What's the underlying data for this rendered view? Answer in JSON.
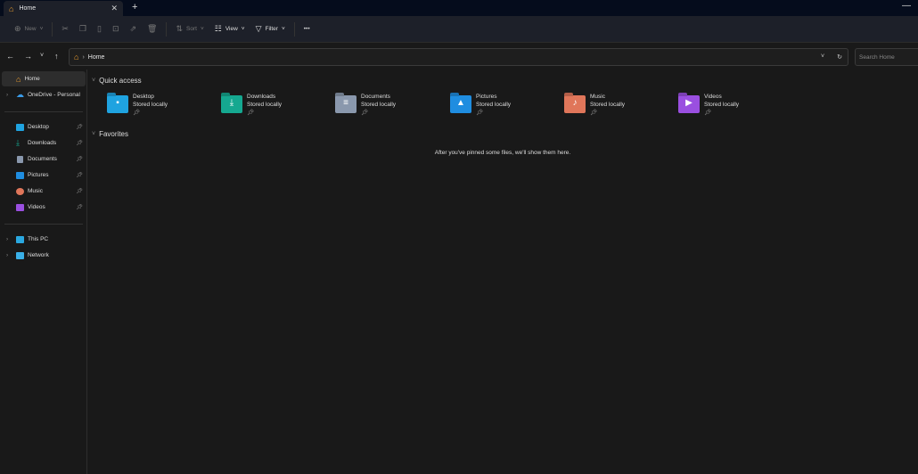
{
  "tab": {
    "title": "Home",
    "close": "✕",
    "new": "+"
  },
  "window": {
    "minimize": "—"
  },
  "toolbar": {
    "new": "New",
    "sort": "Sort",
    "view": "View",
    "filter": "Filter",
    "more": "•••"
  },
  "address": {
    "location": "Home",
    "search_placeholder": "Search Home"
  },
  "sidebar": {
    "home": "Home",
    "onedrive": "OneDrive - Personal",
    "pinned": [
      "Desktop",
      "Downloads",
      "Documents",
      "Pictures",
      "Music",
      "Videos"
    ],
    "this_pc": "This PC",
    "network": "Network"
  },
  "main": {
    "quick_access": "Quick access",
    "favorites": "Favorites",
    "items": [
      {
        "name": "Desktop",
        "status": "Stored locally",
        "color": "#1fa3e0"
      },
      {
        "name": "Downloads",
        "status": "Stored locally",
        "color": "#15a890"
      },
      {
        "name": "Documents",
        "status": "Stored locally",
        "color": "#8a98ad"
      },
      {
        "name": "Pictures",
        "status": "Stored locally",
        "color": "#1f8de0"
      },
      {
        "name": "Music",
        "status": "Stored locally",
        "color": "#e0765a"
      },
      {
        "name": "Videos",
        "status": "Stored locally",
        "color": "#9a4fe0"
      }
    ],
    "empty_message": "After you've pinned some files, we'll show them here."
  }
}
